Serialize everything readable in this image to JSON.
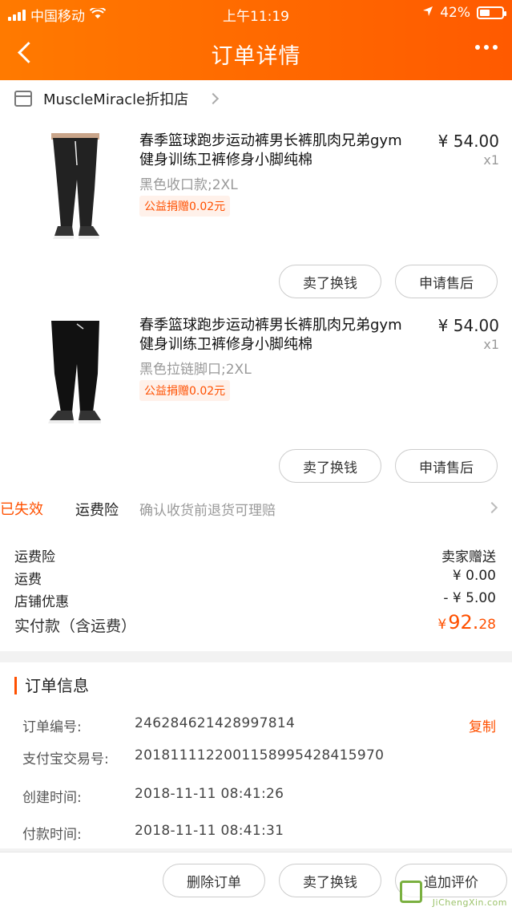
{
  "status_bar": {
    "carrier": "中国移动",
    "time": "上午11:19",
    "battery": "42%"
  },
  "nav": {
    "title": "订单详情"
  },
  "shop": {
    "name": "MuscleMiracle折扣店"
  },
  "items": [
    {
      "title": "春季篮球跑步运动裤男长裤肌肉兄弟gym健身训练卫裤修身小脚纯棉",
      "price": "¥ 54.00",
      "qty": "x1",
      "spec": "黑色收口款;2XL",
      "tag": "公益捐赠0.02元",
      "btn_sell": "卖了换钱",
      "btn_after_sale": "申请售后"
    },
    {
      "title": "春季篮球跑步运动裤男长裤肌肉兄弟gym健身训练卫裤修身小脚纯棉",
      "price": "¥ 54.00",
      "qty": "x1",
      "spec": "黑色拉链脚口;2XL",
      "tag": "公益捐赠0.02元",
      "btn_sell": "卖了换钱",
      "btn_after_sale": "申请售后"
    }
  ],
  "insurance": {
    "label": "运费险",
    "desc": "确认收货前退货可理赔",
    "status": "已失效"
  },
  "summary": {
    "rows": [
      {
        "k": "运费险",
        "v": "卖家赠送"
      },
      {
        "k": "运费",
        "v": "¥ 0.00"
      },
      {
        "k": "店铺优惠",
        "v": "- ¥ 5.00"
      }
    ],
    "total_label": "实付款（含运费）",
    "total_currency": "¥",
    "total_int": "92.",
    "total_dec": "28"
  },
  "order_info": {
    "heading": "订单信息",
    "rows": [
      {
        "k": "订单编号:",
        "v": "246284621428997814",
        "action": "复制"
      },
      {
        "k": "支付宝交易号:",
        "v": "2018111122001158995428415970"
      },
      {
        "k": "创建时间:",
        "v": "2018-11-11 08:41:26"
      },
      {
        "k": "付款时间:",
        "v": "2018-11-11 08:41:31"
      }
    ]
  },
  "bottom_bar": {
    "delete": "删除订单",
    "sell": "卖了换钱",
    "review": "追加评价"
  },
  "watermark": "JiChengXin.com"
}
